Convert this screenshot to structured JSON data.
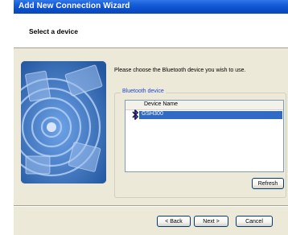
{
  "window": {
    "title": "Add New Connection Wizard"
  },
  "header": {
    "heading": "Select a device"
  },
  "main": {
    "instruction": "Please choose the Bluetooth device you wish to use.",
    "group_label": "Bluetooth device",
    "list": {
      "column_header": "Device Name",
      "rows": [
        {
          "label": "GSH300",
          "icon": "bluetooth-icon",
          "selected": true
        }
      ]
    },
    "refresh_label": "Refresh"
  },
  "footer": {
    "back_label": "< Back",
    "next_label": "Next >",
    "cancel_label": "Cancel"
  },
  "colors": {
    "titlebar": "#0a4cc7",
    "selection": "#316ac5",
    "group_label": "#1f45d8",
    "dialog_bg": "#ece9d8"
  }
}
